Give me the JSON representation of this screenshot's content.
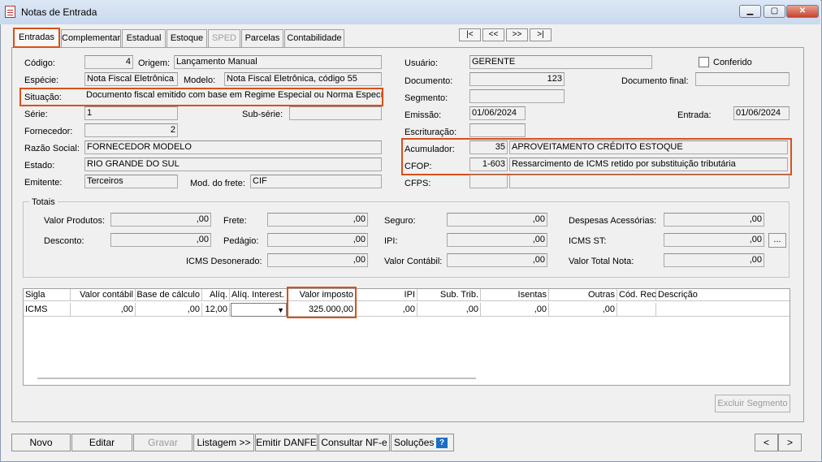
{
  "window": {
    "title": "Notas de Entrada",
    "minimize": "▁",
    "maximize": "▢",
    "close": "✕"
  },
  "tabs": [
    "Entradas",
    "Complementar",
    "Estadual",
    "Estoque",
    "SPED",
    "Parcelas",
    "Contabilidade"
  ],
  "nav": {
    "first": "|<",
    "prev": "<<",
    "next": ">>",
    "last": ">|"
  },
  "form": {
    "codigo_label": "Código:",
    "codigo": "4",
    "origem_label": "Origem:",
    "origem": "Lançamento Manual",
    "usuario_label": "Usuário:",
    "usuario": "GERENTE",
    "conferido_label": "Conferido",
    "especie_label": "Espécie:",
    "especie": "Nota Fiscal Eletrônica",
    "modelo_label": "Modelo:",
    "modelo": "Nota Fiscal Eletrônica, código 55",
    "documento_label": "Documento:",
    "documento": "123",
    "documento_final_label": "Documento final:",
    "documento_final": "",
    "situacao_label": "Situação:",
    "situacao": "Documento fiscal emitido com base em Regime Especial ou Norma Específic",
    "segmento_label": "Segmento:",
    "segmento": "",
    "serie_label": "Série:",
    "serie": "1",
    "subserie_label": "Sub-série:",
    "subserie": "",
    "emissao_label": "Emissão:",
    "emissao": "01/06/2024",
    "entrada_label": "Entrada:",
    "entrada": "01/06/2024",
    "fornecedor_label": "Fornecedor:",
    "fornecedor": "2",
    "escrituracao_label": "Escrituração:",
    "escrituracao": "",
    "razao_label": "Razão Social:",
    "razao": "FORNECEDOR MODELO",
    "acumulador_label": "Acumulador:",
    "acumulador_code": "35",
    "acumulador_desc": "APROVEITAMENTO CRÉDITO ESTOQUE",
    "estado_label": "Estado:",
    "estado": "RIO GRANDE DO SUL",
    "cfop_label": "CFOP:",
    "cfop_code": "1-603",
    "cfop_desc": "Ressarcimento de ICMS retido por substituição tributária",
    "emitente_label": "Emitente:",
    "emitente": "Terceiros",
    "frete_mod_label": "Mod. do frete:",
    "frete_mod": "CIF",
    "cfps_label": "CFPS:",
    "cfps_code": "",
    "cfps_desc": ""
  },
  "totais": {
    "title": "Totais",
    "valor_produtos_label": "Valor Produtos:",
    "valor_produtos": ",00",
    "frete_label": "Frete:",
    "frete": ",00",
    "seguro_label": "Seguro:",
    "seguro": ",00",
    "despesas_label": "Despesas Acessórias:",
    "despesas": ",00",
    "desconto_label": "Desconto:",
    "desconto": ",00",
    "pedagio_label": "Pedágio:",
    "pedagio": ",00",
    "ipi_label": "IPI:",
    "ipi": ",00",
    "icms_st_label": "ICMS ST:",
    "icms_st": ",00",
    "icms_st_btn": "...",
    "icms_deson_label": "ICMS Desonerado:",
    "icms_deson": ",00",
    "valor_contabil_label": "Valor Contábil:",
    "valor_contabil": ",00",
    "valor_total_label": "Valor Total Nota:",
    "valor_total": ",00"
  },
  "grid": {
    "headers": [
      "Sigla",
      "Valor contábil",
      "Base de cálculo",
      "Alíq.",
      "Alíq. Interest.",
      "Valor imposto",
      "IPI",
      "Sub. Trib.",
      "Isentas",
      "Outras",
      "Cód. Rec.",
      "Descrição"
    ],
    "row": [
      "ICMS",
      ",00",
      ",00",
      "12,00",
      "",
      "325.000,00",
      ",00",
      ",00",
      ",00",
      ",00",
      "",
      ""
    ]
  },
  "excluir_segmento": "Excluir Segmento",
  "buttons": {
    "novo": "Novo",
    "editar": "Editar",
    "gravar": "Gravar",
    "listagem": "Listagem >>",
    "emitir_danfe": "Emitir DANFE",
    "consultar_nfe": "Consultar NF-e",
    "solucoes": "Soluções",
    "help": "?",
    "prev": "<",
    "next": ">"
  }
}
